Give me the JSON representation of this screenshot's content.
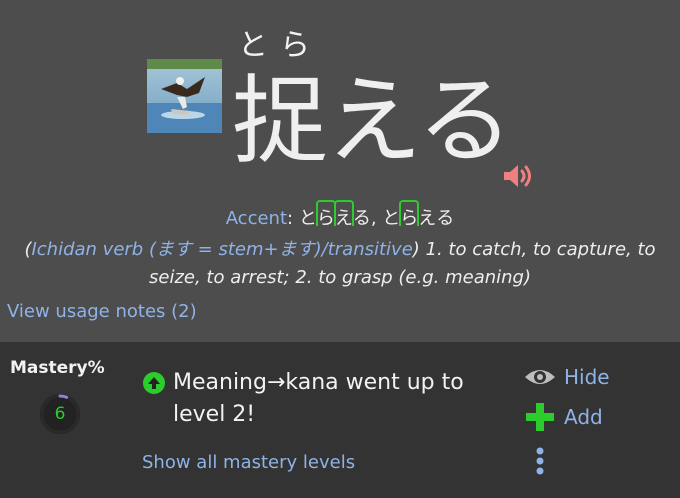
{
  "word": {
    "furigana": "とら",
    "kanji": "捉える"
  },
  "accent": {
    "label": "Accent",
    "colon": ":",
    "forms": [
      {
        "chars": [
          "と",
          "ら",
          "え",
          "る"
        ],
        "marked": [
          false,
          true,
          true,
          false
        ]
      },
      {
        "chars": [
          "と",
          "ら",
          "え",
          "る"
        ],
        "marked": [
          false,
          true,
          false,
          false
        ]
      }
    ],
    "separator": ", "
  },
  "definition": {
    "open_paren": "(",
    "pos": "Ichidan verb (ます = stem+ます)/transitive",
    "close_paren": ")",
    "text": " 1. to catch, to capture, to seize, to arrest; 2. to grasp (e.g. meaning)"
  },
  "usage_notes": {
    "label": "View usage notes (2)"
  },
  "mastery": {
    "title": "Mastery%",
    "value": "6",
    "progress_fraction": 0.06,
    "message": "Meaning→kana went up to level 2!",
    "show_all_label": "Show all mastery levels"
  },
  "actions": {
    "hide_label": "Hide",
    "add_label": "Add"
  },
  "colors": {
    "link": "#8fb3e8",
    "accent_green": "#2bcc2b",
    "speaker": "#f08080"
  }
}
